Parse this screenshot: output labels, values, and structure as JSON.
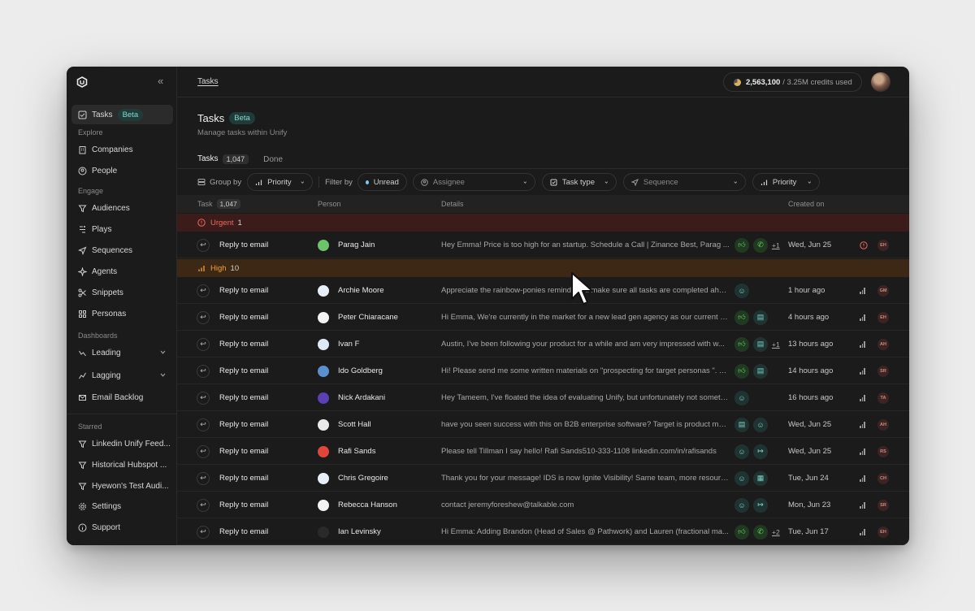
{
  "sidebar": {
    "collapse_icon": "«",
    "tasks": {
      "label": "Tasks",
      "badge": "Beta"
    },
    "explore_label": "Explore",
    "explore": [
      {
        "label": "Companies"
      },
      {
        "label": "People"
      }
    ],
    "engage_label": "Engage",
    "engage": [
      {
        "label": "Audiences"
      },
      {
        "label": "Plays"
      },
      {
        "label": "Sequences"
      },
      {
        "label": "Agents"
      },
      {
        "label": "Snippets"
      },
      {
        "label": "Personas"
      }
    ],
    "dashboards_label": "Dashboards",
    "dashboards": [
      {
        "label": "Leading"
      },
      {
        "label": "Lagging"
      },
      {
        "label": "Email Backlog"
      }
    ],
    "starred_label": "Starred",
    "starred": [
      {
        "label": "Linkedin Unify Feed..."
      },
      {
        "label": "Historical Hubspot ..."
      },
      {
        "label": "Hyewon's Test Audi..."
      }
    ],
    "settings": "Settings",
    "support": "Support"
  },
  "topbar": {
    "breadcrumb": "Tasks",
    "credits_used": "2,563,100",
    "credits_total": "/ 3.25M credits used"
  },
  "page": {
    "title": "Tasks",
    "badge": "Beta",
    "subtitle": "Manage tasks within Unify"
  },
  "tabs": [
    {
      "label": "Tasks",
      "count": "1,047"
    },
    {
      "label": "Done"
    }
  ],
  "filters": {
    "group_by": "Group by",
    "group_value": "Priority",
    "filter_by": "Filter by",
    "unread": "Unread",
    "assignee": "Assignee",
    "task_type": "Task type",
    "sequence": "Sequence",
    "priority": "Priority"
  },
  "columns": {
    "task": "Task",
    "task_count": "1,047",
    "person": "Person",
    "details": "Details",
    "created": "Created on"
  },
  "groups": {
    "urgent": {
      "label": "Urgent",
      "count": "1"
    },
    "high": {
      "label": "High",
      "count": "10"
    }
  },
  "rows": [
    {
      "task": "Reply to email",
      "person": "Parag Jain",
      "details": "Hey Emma! Price is too high for an startup. Schedule a Call | Zinance Best, Parag ...",
      "created": "Wed, Jun 25",
      "owner": "EH",
      "actions": [
        "thumbs-up-icon",
        "phone-icon"
      ],
      "more": "+1",
      "avatar_color": "#6cc36a"
    },
    {
      "task": "Reply to email",
      "person": "Archie Moore",
      "details": "Appreciate the rainbow-ponies reminder. I'll make sure all tasks are completed ahead of ti...",
      "created": "1 hour ago",
      "owner": "GM",
      "actions": [
        "smile-icon"
      ],
      "more": "",
      "avatar_color": "#e8eef7"
    },
    {
      "task": "Reply to email",
      "person": "Peter Chiaracane",
      "details": "Hi Emma, We're currently in the market for a new lead gen agency as our current ven...",
      "created": "4 hours ago",
      "owner": "EH",
      "actions": [
        "thumbs-up-icon",
        "message-icon"
      ],
      "more": "",
      "avatar_color": "#f2f2f2"
    },
    {
      "task": "Reply to email",
      "person": "Ivan F",
      "details": "Austin, I've been following your product for a while and am very impressed with w...",
      "created": "13 hours ago",
      "owner": "AH",
      "actions": [
        "thumbs-up-icon",
        "message-icon"
      ],
      "more": "+1",
      "avatar_color": "#dfe8f5"
    },
    {
      "task": "Reply to email",
      "person": "Ido Goldberg",
      "details": "Hi! Please send me some written materials on \"prospecting for target personas \". Th...",
      "created": "14 hours ago",
      "owner": "SR",
      "actions": [
        "thumbs-up-icon",
        "message-icon"
      ],
      "more": "",
      "avatar_color": "#5a8fd0"
    },
    {
      "task": "Reply to email",
      "person": "Nick Ardakani",
      "details": "Hey Tameem, I've floated the idea of evaluating Unify, but unfortunately not something our ...",
      "created": "16 hours ago",
      "owner": "TA",
      "actions": [
        "smile-icon"
      ],
      "more": "",
      "avatar_color": "#5a3fb5"
    },
    {
      "task": "Reply to email",
      "person": "Scott Hall",
      "details": "have you seen success with this on B2B enterprise software? Target is product man...",
      "created": "Wed, Jun 25",
      "owner": "AH",
      "actions": [
        "message-icon",
        "smile-icon"
      ],
      "more": "",
      "avatar_color": "#eaeaea"
    },
    {
      "task": "Reply to email",
      "person": "Rafi Sands",
      "details": "Please tell Tillman I say hello! Rafi Sands510-333-1108 linkedin.com/in/rafisands",
      "created": "Wed, Jun 25",
      "owner": "RS",
      "actions": [
        "smile-icon",
        "arrow-icon"
      ],
      "more": "",
      "avatar_color": "#e0463a"
    },
    {
      "task": "Reply to email",
      "person": "Chris Gregoire",
      "details": "Thank you for your message! IDS is now Ignite Visibility! Same team, more resources,...",
      "created": "Tue, Jun 24",
      "owner": "CH",
      "actions": [
        "smile-icon",
        "calendar-icon"
      ],
      "more": "",
      "avatar_color": "#e8eef7"
    },
    {
      "task": "Reply to email",
      "person": "Rebecca Hanson",
      "details": "contact jeremyforeshew@talkable.com",
      "created": "Mon, Jun 23",
      "owner": "SR",
      "actions": [
        "smile-icon",
        "arrow-icon"
      ],
      "more": "",
      "avatar_color": "#f2f2f2"
    },
    {
      "task": "Reply to email",
      "person": "Ian Levinsky",
      "details": "Hi Emma: Adding Brandon (Head of Sales @ Pathwork) and Lauren (fractional ma...",
      "created": "Tue, Jun 17",
      "owner": "EH",
      "actions": [
        "thumbs-up-icon",
        "phone-icon"
      ],
      "more": "+2",
      "avatar_color": "#2a2a2a"
    }
  ]
}
